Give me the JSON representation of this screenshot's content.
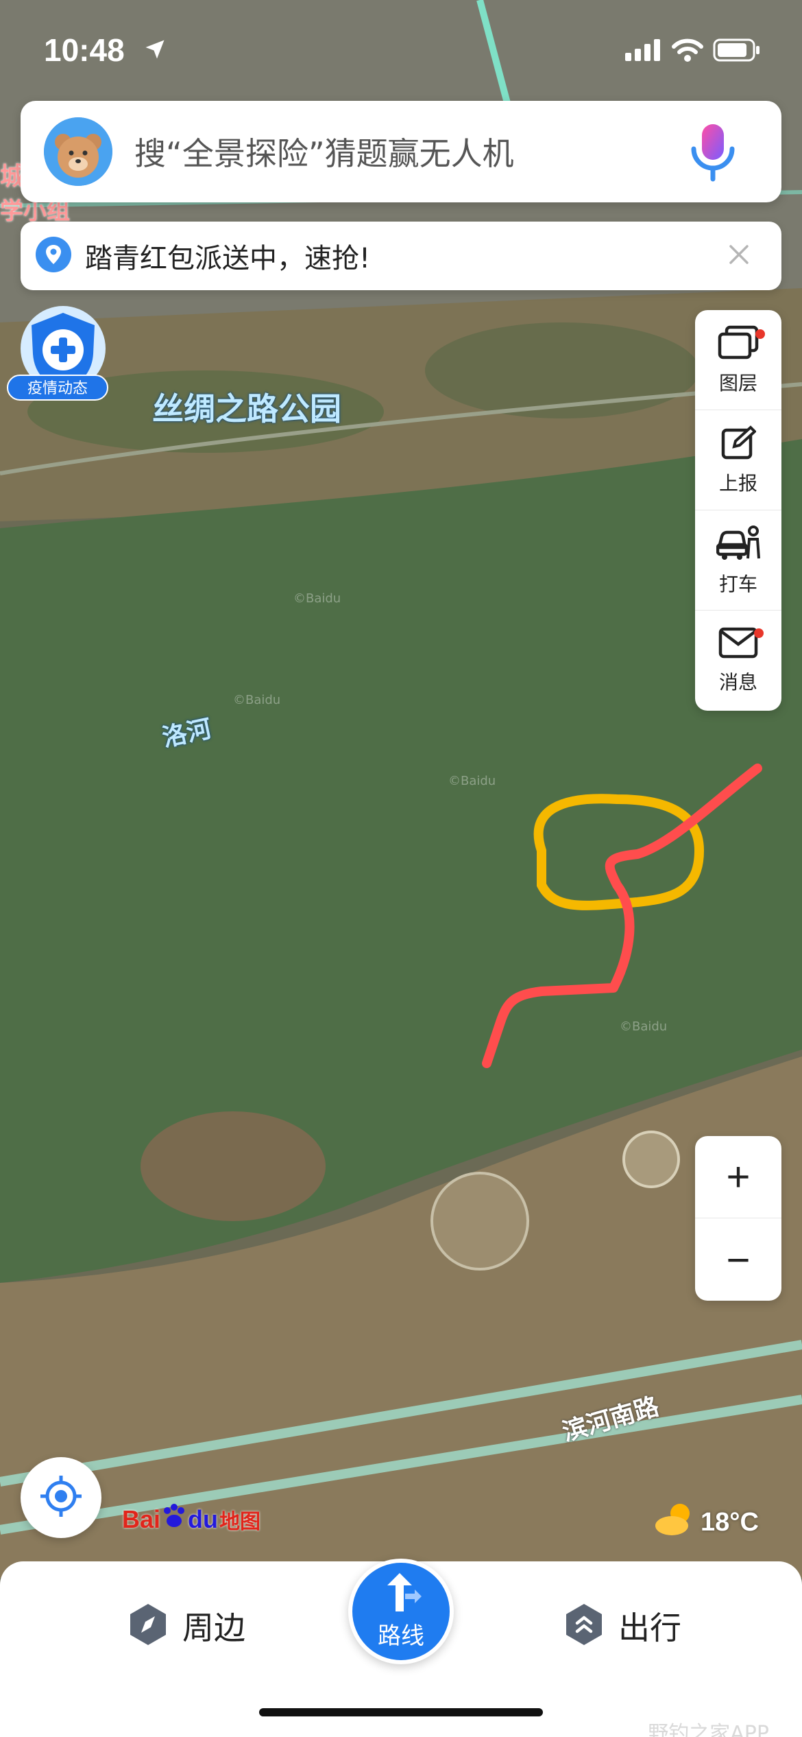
{
  "status_bar": {
    "time": "10:48"
  },
  "search": {
    "placeholder_text": "搜“全景探险”猜题赢无人机"
  },
  "notice": {
    "text": "踏青红包派送中，速抢!"
  },
  "epidemic": {
    "label": "疫情动态"
  },
  "map": {
    "place_labels": {
      "park": "丝绸之路公园",
      "river": "洛河",
      "road": "滨河南路",
      "edge_top_1": "城",
      "edge_top_2": "学小组"
    },
    "watermarks": [
      "©Baidu",
      "©Baidu",
      "©Baidu",
      "©Baidu"
    ],
    "annotation_colors": {
      "circle": "#f5b800",
      "path": "#ff4d4d"
    }
  },
  "tools": [
    {
      "name": "layers",
      "label": "图层",
      "has_dot": true
    },
    {
      "name": "report",
      "label": "上报",
      "has_dot": false
    },
    {
      "name": "taxi",
      "label": "打车",
      "has_dot": false
    },
    {
      "name": "message",
      "label": "消息",
      "has_dot": true
    }
  ],
  "zoom": {
    "in_label": "+",
    "out_label": "−"
  },
  "brand": {
    "bai": "Bai",
    "du": "du",
    "ditu": "地图"
  },
  "weather": {
    "temperature": "18°C"
  },
  "bottom_nav": {
    "nearby": "周边",
    "route": "路线",
    "travel": "出行"
  },
  "watermark": "野钓之家APP",
  "colors": {
    "accent": "#1f7cf0",
    "water": "#4f6e47"
  }
}
